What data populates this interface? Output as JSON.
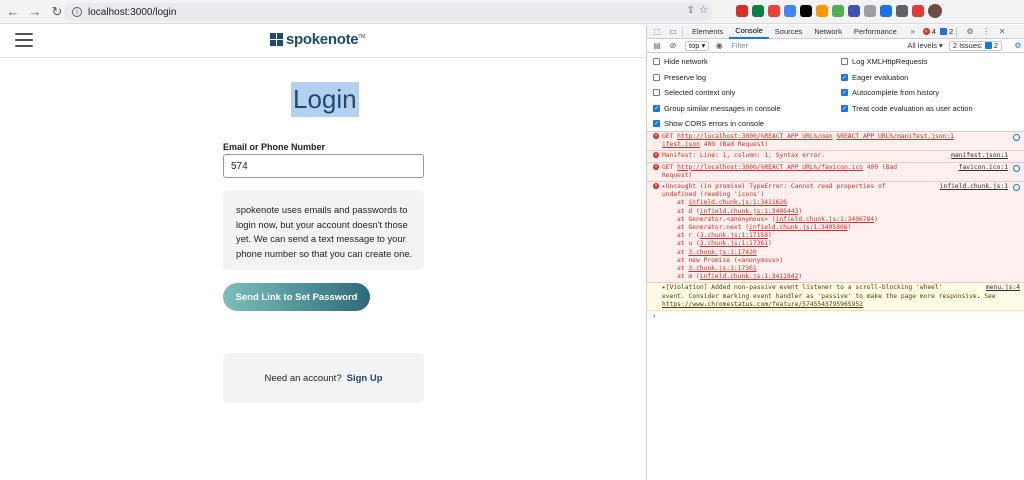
{
  "browser": {
    "url": "localhost:3000/login",
    "extension_colors": [
      "#d93025",
      "#0b8043",
      "#ea4335",
      "#4285f4",
      "#000000",
      "#ff9800",
      "#4caf50",
      "#3f51b5",
      "#9e9e9e",
      "#1a73e8",
      "#5f6368",
      "#e53935"
    ]
  },
  "page": {
    "logo_text": "spokenote",
    "logo_tm": "TM",
    "title": "Login",
    "email_label": "Email or Phone Number",
    "email_value": "574",
    "info_text": "spokenote uses emails and passwords to login now, but your account doesn't those yet. We can send a text message to your phone number so that you can create one.",
    "send_button": "Send Link to Set Password",
    "signup_prompt": "Need an account?",
    "signup_link": "Sign Up",
    "accent_color": "#1e4a6d"
  },
  "devtools": {
    "tabs": [
      "Elements",
      "Console",
      "Sources",
      "Network",
      "Performance"
    ],
    "active_tab": "Console",
    "error_count": "4",
    "warning_count": "2",
    "context": "top",
    "filter_placeholder": "Filter",
    "levels": "All levels",
    "issues_label": "2 Issues:",
    "issues_count": "2",
    "settings_left": [
      {
        "label": "Hide network",
        "checked": false
      },
      {
        "label": "Preserve log",
        "checked": false
      },
      {
        "label": "Selected context only",
        "checked": false
      },
      {
        "label": "Group similar messages in console",
        "checked": true
      },
      {
        "label": "Show CORS errors in console",
        "checked": true
      }
    ],
    "settings_right": [
      {
        "label": "Log XMLHttpRequests",
        "checked": false
      },
      {
        "label": "Eager evaluation",
        "checked": true
      },
      {
        "label": "Autocomplete from history",
        "checked": true
      },
      {
        "label": "Treat code evaluation as user action",
        "checked": true
      }
    ],
    "messages": {
      "m1_get": "GET",
      "m1_url_a": "http://localhost:3000/%REACT_APP_URL%/man",
      "m1_url_b": "%REACT_APP_URL%/manifest.json:1",
      "m1_line2_url": "ifest.json",
      "m1_line2_rest": " 400 (Bad Request)",
      "m2_text": "Manifest: Line: 1, column: 1, Syntax error.",
      "m2_src": "manifest.json:1",
      "m3_get": "GET",
      "m3_url": "http://localhost:3000/%REACT_APP_URL%/favicon.ico",
      "m3_rest": " 400 (Bad",
      "m3_line2": "Request)",
      "m3_src": "favicon.ico:1",
      "m4_line1": "Uncaught (in promise) TypeError: Cannot read properties of",
      "m4_line2": "undefined (reading 'icons')",
      "m4_src": "infield.chunk.js:1",
      "stack": [
        {
          "pre": "at ",
          "url": "infield.chunk.js:1:3411626",
          "post": ""
        },
        {
          "pre": "at d (",
          "url": "infield.chunk.js:1:3405443",
          "post": ")"
        },
        {
          "pre": "at Generator.<anonymous> (",
          "url": "infield.chunk.js:1:3406784",
          "post": ")"
        },
        {
          "pre": "at Generator.next (",
          "url": "infield.chunk.js:1:3405806",
          "post": ")"
        },
        {
          "pre": "at r (",
          "url": "3.chunk.js:1:17158",
          "post": ")"
        },
        {
          "pre": "at u (",
          "url": "3.chunk.js:1:17361",
          "post": ")"
        },
        {
          "pre": "at ",
          "url": "3.chunk.js:1:17420",
          "post": ""
        },
        {
          "pre": "at new Promise (<anonymous>)",
          "url": "",
          "post": ""
        },
        {
          "pre": "at ",
          "url": "3.chunk.js:1:17301",
          "post": ""
        },
        {
          "pre": "at m (",
          "url": "infield.chunk.js:1:3411942",
          "post": ")"
        }
      ],
      "warn_line1": "[Violation] Added non-passive event listener to a scroll-blocking 'wheel'",
      "warn_line2": "event. Consider marking event handler as 'passive' to make the page more responsive. See",
      "warn_url": "https://www.chromestatus.com/feature/5745543795965952",
      "warn_src": "menu.js:4",
      "prompt": "›"
    }
  }
}
